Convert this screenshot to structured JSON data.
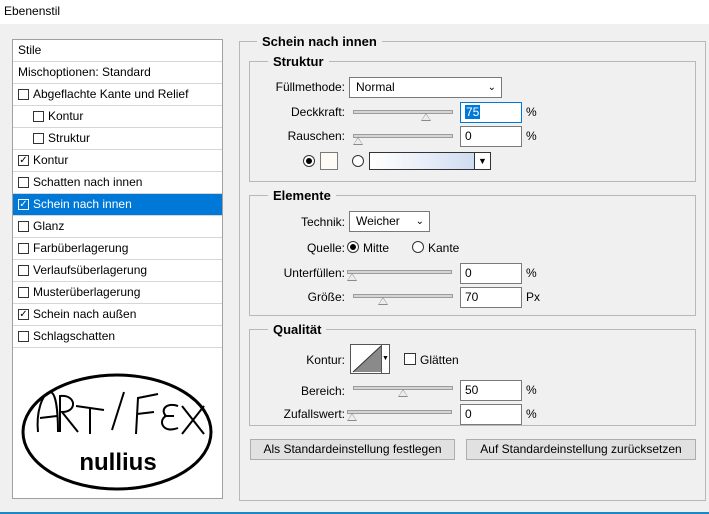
{
  "window": {
    "title": "Ebenenstil"
  },
  "sidebar": {
    "header_stile": "Stile",
    "header_mischoptionen": "Mischoptionen: Standard",
    "items": [
      {
        "label": "Abgeflachte Kante und Relief",
        "checked": false
      },
      {
        "label": "Kontur",
        "checked": false
      },
      {
        "label": "Struktur",
        "checked": false
      },
      {
        "label": "Kontur",
        "checked": true
      },
      {
        "label": "Schatten nach innen",
        "checked": false
      },
      {
        "label": "Schein nach innen",
        "checked": true,
        "selected": true
      },
      {
        "label": "Glanz",
        "checked": false
      },
      {
        "label": "Farbüberlagerung",
        "checked": false
      },
      {
        "label": "Verlaufsüberlagerung",
        "checked": false
      },
      {
        "label": "Musterüberlagerung",
        "checked": false
      },
      {
        "label": "Schein nach außen",
        "checked": true
      },
      {
        "label": "Schlagschatten",
        "checked": false
      }
    ],
    "check_mark": "✓",
    "logo": {
      "line1": "ART / FEX",
      "line2": "nullius"
    }
  },
  "panel": {
    "title": "Schein nach innen",
    "struktur": {
      "legend": "Struktur",
      "fuellmethode_label": "Füllmethode:",
      "fuellmethode_value": "Normal",
      "deckkraft_label": "Deckkraft:",
      "deckkraft_value": "75",
      "deckkraft_unit": "%",
      "rauschen_label": "Rauschen:",
      "rauschen_value": "0",
      "rauschen_unit": "%",
      "color_mode": "solid",
      "swatch_color": "#fcfbf6",
      "opacity_fraction": 0.75,
      "noise_fraction": 0.0
    },
    "elemente": {
      "legend": "Elemente",
      "technik_label": "Technik:",
      "technik_value": "Weicher",
      "quelle_label": "Quelle:",
      "quelle_mitte": "Mitte",
      "quelle_kante": "Kante",
      "quelle_selected": "Mitte",
      "unterfuellen_label": "Unterfüllen:",
      "unterfuellen_value": "0",
      "unterfuellen_unit": "%",
      "groesse_label": "Größe:",
      "groesse_value": "70",
      "groesse_unit": "Px",
      "choke_fraction": 0.0,
      "size_fraction": 0.28
    },
    "qualitaet": {
      "legend": "Qualität",
      "kontur_label": "Kontur:",
      "glaetten_label": "Glätten",
      "glaetten_checked": false,
      "bereich_label": "Bereich:",
      "bereich_value": "50",
      "bereich_unit": "%",
      "zufallswert_label": "Zufallswert:",
      "zufallswert_value": "0",
      "zufallswert_unit": "%",
      "range_fraction": 0.5,
      "jitter_fraction": 0.0
    },
    "buttons": {
      "set_default": "Als Standardeinstellung festlegen",
      "reset_default": "Auf Standardeinstellung zurücksetzen"
    }
  },
  "colors": {
    "accent": "#0078d7",
    "selection_text": "#ffffff"
  }
}
